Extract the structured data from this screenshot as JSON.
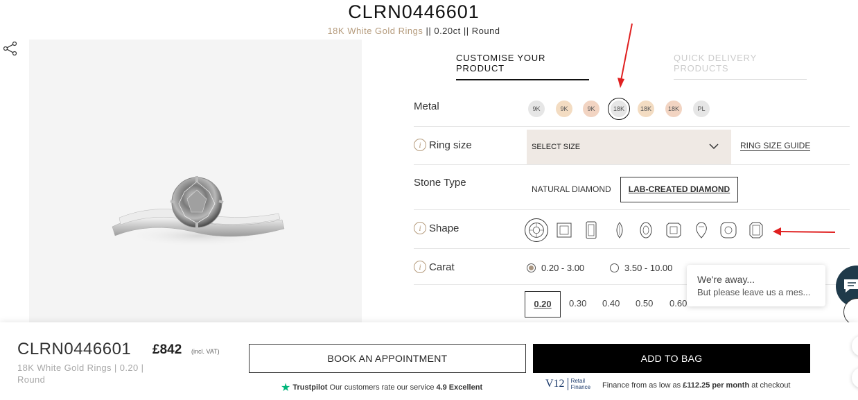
{
  "product": {
    "code": "CLRN0446601",
    "subtitle_gold": "18K White Gold Rings",
    "subtitle_rest": " || 0.20ct || Round"
  },
  "tabs": {
    "customise": "CUSTOMISE YOUR PRODUCT",
    "quick": "QUICK DELIVERY PRODUCTS"
  },
  "options": {
    "metal_label": "Metal",
    "metals": [
      {
        "label": "9K",
        "color": "#e6e6e6"
      },
      {
        "label": "9K",
        "color": "#f3dcc2"
      },
      {
        "label": "9K",
        "color": "#f2d4c2"
      },
      {
        "label": "18K",
        "color": "#e6e6e6",
        "selected": true
      },
      {
        "label": "18K",
        "color": "#f3dcc2"
      },
      {
        "label": "18K",
        "color": "#f2d4c2"
      },
      {
        "label": "PL",
        "color": "#e6e6e6"
      }
    ],
    "ring_size_label": "Ring size",
    "ring_size_select": "SELECT SIZE",
    "ring_size_guide": "RING SIZE GUIDE",
    "stone_type_label": "Stone Type",
    "stone_natural": "NATURAL DIAMOND",
    "stone_lab": "LAB-CREATED DIAMOND",
    "shape_label": "Shape",
    "shapes": [
      "round-icon",
      "princess-icon",
      "emerald-icon",
      "marquise-icon",
      "oval-icon",
      "radiant-icon",
      "pear-icon",
      "cushion-icon",
      "asscher-icon"
    ],
    "carat_label": "Carat",
    "carat_ranges": [
      "0.20 - 3.00",
      "3.50 - 10.00"
    ],
    "carat_values": [
      "0.20",
      "0.30",
      "0.40",
      "0.50",
      "0.60"
    ]
  },
  "chat": {
    "title": "We're away...",
    "message": "But please leave us a mes..."
  },
  "footer": {
    "code": "CLRN0446601",
    "price": "£842",
    "vat": "(incl. VAT)",
    "subtitle": "18K White Gold Rings | 0.20 | Round",
    "appointment_button": "BOOK AN APPOINTMENT",
    "bag_button": "ADD TO BAG",
    "trustpilot_brand": "Trustpilot",
    "trustpilot_text": "Our customers rate our service",
    "trustpilot_score": "4.9 Excellent",
    "finance_logo": "V12",
    "finance_logo_sub": "Retail Finance",
    "finance_prefix": "Finance from as low as",
    "finance_amount": "£112.25 per month",
    "finance_suffix": "at checkout"
  },
  "colors": {
    "accent_gold": "#b59b7c",
    "annotation_red": "#e02020",
    "chat_blue": "#1f3a4a",
    "trustpilot_green": "#00b67a"
  }
}
